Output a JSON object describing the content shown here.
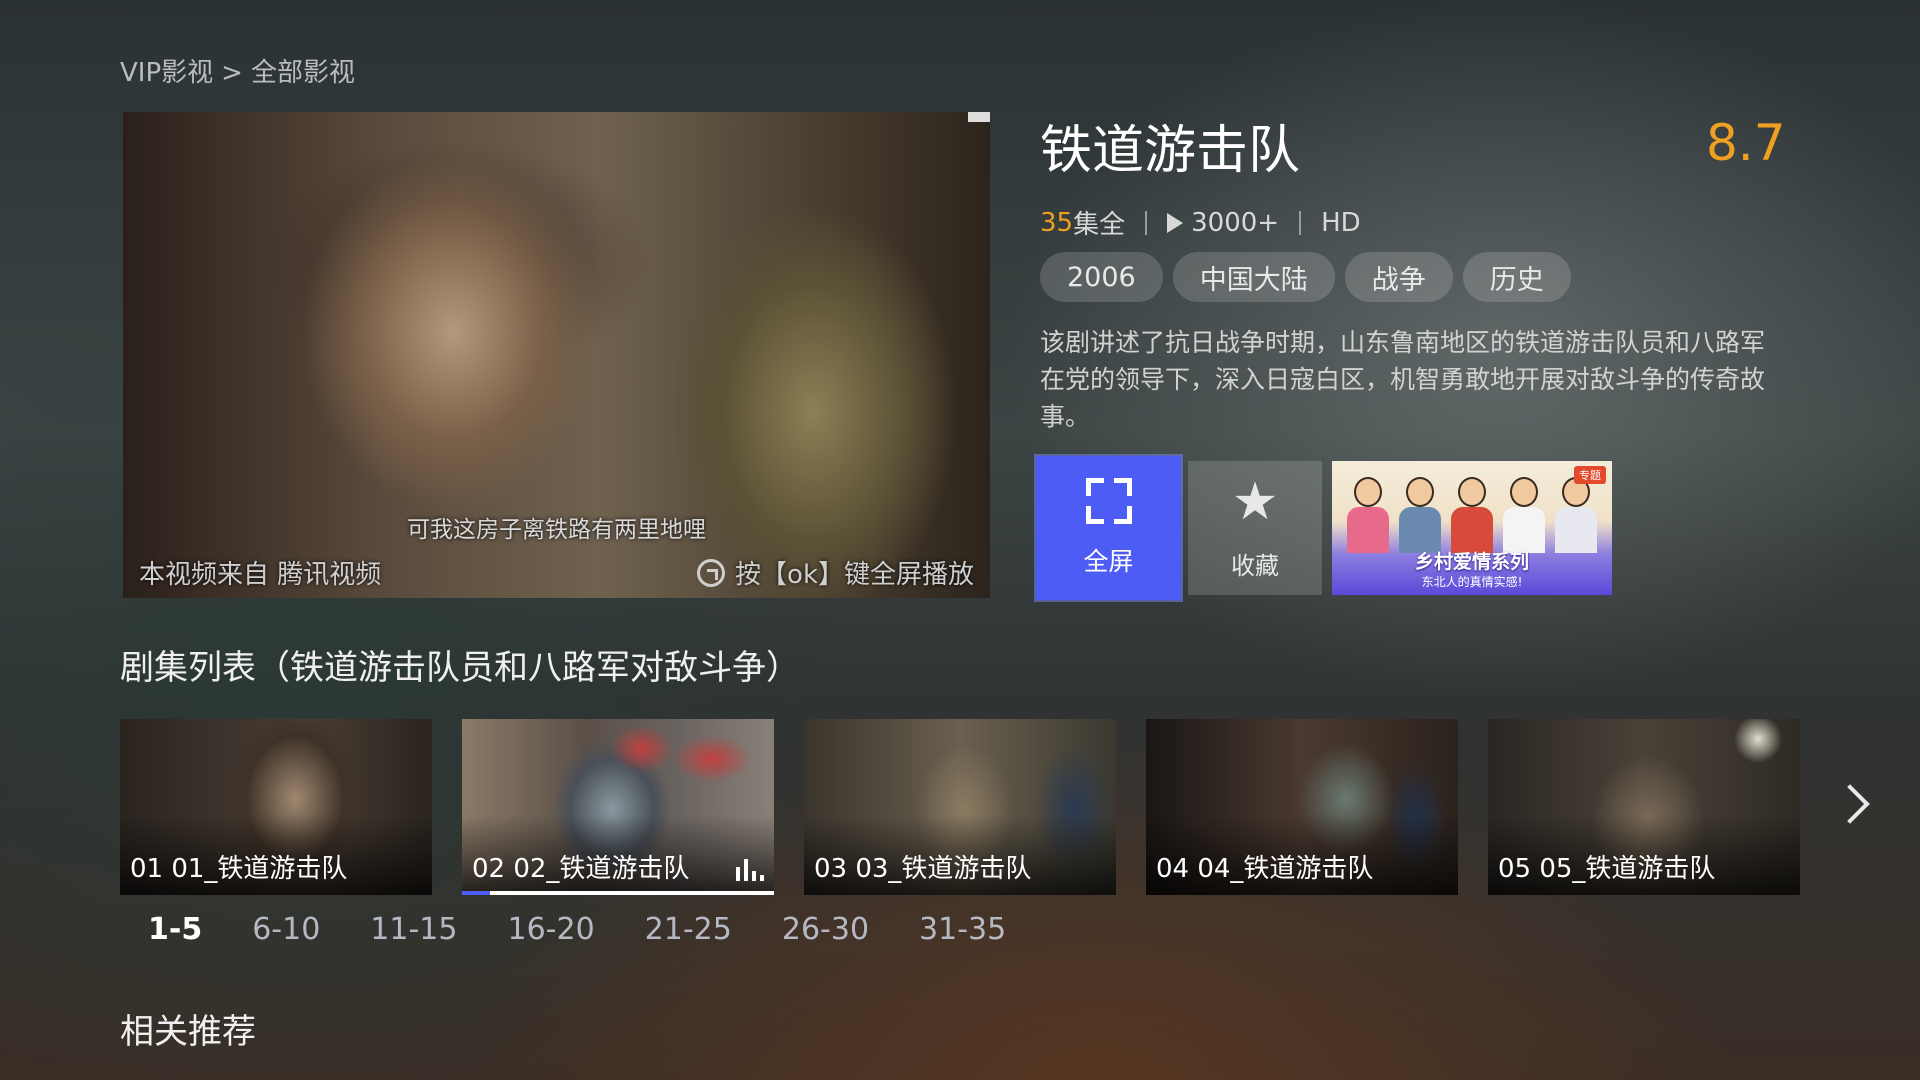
{
  "breadcrumb": {
    "parent": "VIP影视",
    "separator": ">",
    "current": "全部影视"
  },
  "player": {
    "subtitle": "可我这房子离铁路有两里地哩",
    "source": "本视频来自 腾讯视频",
    "hint": "按【ok】键全屏播放"
  },
  "detail": {
    "title": "铁道游击队",
    "rating": "8.7",
    "episodes_count": "35",
    "episodes_suffix": "集全",
    "play_count": "3000+",
    "quality": "HD",
    "tags": [
      "2006",
      "中国大陆",
      "战争",
      "历史"
    ],
    "description": "该剧讲述了抗日战争时期，山东鲁南地区的铁道游击队员和八路军在党的领导下，深入日寇白区，机智勇敢地开展对敌斗争的传奇故事。"
  },
  "actions": {
    "fullscreen_label": "全屏",
    "favorite_label": "收藏"
  },
  "promo": {
    "badge": "专题",
    "title": "乡村爱情系列",
    "subtitle": "东北人的真情实感!"
  },
  "episode_section": {
    "title": "剧集列表（铁道游击队员和八路军对敌斗争）",
    "episodes": [
      {
        "label": "01 01_铁道游击队",
        "active": false
      },
      {
        "label": "02 02_铁道游击队",
        "active": true,
        "progress": 0.09
      },
      {
        "label": "03 03_铁道游击队",
        "active": false
      },
      {
        "label": "04 04_铁道游击队",
        "active": false
      },
      {
        "label": "05 05_铁道游击队",
        "active": false
      }
    ],
    "ranges": [
      "1-5",
      "6-10",
      "11-15",
      "16-20",
      "21-25",
      "26-30",
      "31-35"
    ],
    "active_range": "1-5"
  },
  "related_section": {
    "title": "相关推荐"
  },
  "colors": {
    "accent": "#4c5cf5",
    "rating": "#f0a020"
  },
  "icons": {
    "fullscreen": "expand-icon",
    "favorite": "star-icon",
    "next": "chevron-right-icon",
    "playing": "equalizer-icon"
  }
}
